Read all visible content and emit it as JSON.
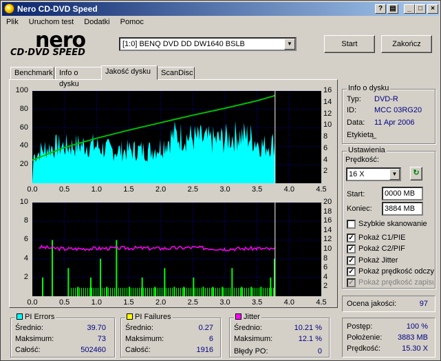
{
  "window": {
    "title": "Nero CD-DVD Speed",
    "title_buttons": [
      "?",
      "_",
      "□",
      "×"
    ]
  },
  "menu": [
    "Plik",
    "Uruchom test",
    "Dodatki",
    "Pomoc"
  ],
  "logo": {
    "brand": "nero",
    "sub": "CD·DVD SPEED"
  },
  "drive": {
    "selected": "[1:0]  BENQ DVD DD DW1640 BSLB"
  },
  "buttons": {
    "start": "Start",
    "close": "Zakończ"
  },
  "tabs": [
    {
      "label": "Benchmark"
    },
    {
      "label": "Info o dysku"
    },
    {
      "label": "Jakość dysku",
      "active": true
    },
    {
      "label": "ScanDisc"
    }
  ],
  "chart_data": [
    {
      "type": "area",
      "title": "PI Errors / read speed",
      "x_ticks": [
        "0.0",
        "0.5",
        "1.0",
        "1.5",
        "2.0",
        "2.5",
        "3.0",
        "3.5",
        "4.0",
        "4.5"
      ],
      "y_left_ticks": [
        "100",
        "80",
        "60",
        "40",
        "20"
      ],
      "y_right_ticks": [
        "16",
        "14",
        "12",
        "10",
        "8",
        "6",
        "4",
        "2"
      ],
      "xlim": [
        0,
        4.5
      ],
      "ylim": [
        0,
        100
      ],
      "y2lim": [
        0,
        16
      ],
      "scan_end_x": 3.78,
      "series": [
        {
          "name": "PI Errors",
          "color": "#00ffff",
          "x": [
            0.02,
            0.2,
            0.4,
            0.6,
            0.8,
            1.0,
            1.2,
            1.4,
            1.6,
            1.8,
            2.0,
            2.2,
            2.4,
            2.6,
            2.8,
            3.0,
            3.2,
            3.4,
            3.6,
            3.78
          ],
          "values": [
            30,
            38,
            40,
            40,
            42,
            40,
            36,
            35,
            36,
            35,
            40,
            52,
            50,
            48,
            46,
            48,
            52,
            50,
            40,
            44
          ]
        },
        {
          "name": "Read speed",
          "color": "#00c000",
          "x": [
            0.0,
            0.5,
            1.0,
            1.5,
            2.0,
            2.5,
            3.0,
            3.5,
            3.78
          ],
          "values": [
            4.0,
            6.2,
            7.8,
            9.2,
            10.5,
            11.8,
            13.0,
            14.3,
            15.2
          ]
        }
      ]
    },
    {
      "type": "bar",
      "title": "PI Failures / Jitter",
      "x_ticks": [
        "0.0",
        "0.5",
        "1.0",
        "1.5",
        "2.0",
        "2.5",
        "3.0",
        "3.5",
        "4.0",
        "4.5"
      ],
      "y_left_ticks": [
        "10",
        "8",
        "6",
        "4",
        "2"
      ],
      "y_right_ticks": [
        "20",
        "18",
        "16",
        "14",
        "12",
        "10",
        "8",
        "6",
        "4",
        "2"
      ],
      "xlim": [
        0,
        4.5
      ],
      "ylim": [
        0,
        10
      ],
      "y2lim": [
        0,
        20
      ],
      "scan_end_x": 3.78,
      "series": [
        {
          "name": "PI Failures",
          "color": "#00ff00",
          "x": [
            0.15,
            0.3,
            0.55,
            0.7,
            0.9,
            1.05,
            1.15,
            1.3,
            1.5,
            1.7,
            1.9,
            2.05,
            2.2,
            2.35,
            2.5,
            2.65,
            2.8,
            2.95,
            3.1,
            3.25,
            3.4,
            3.55,
            3.7,
            3.76
          ],
          "values": [
            2,
            6,
            3,
            1,
            2,
            4,
            1,
            6,
            1,
            2,
            1,
            3,
            1,
            1,
            2,
            1,
            1,
            1,
            3,
            1,
            1,
            1,
            2,
            4
          ]
        },
        {
          "name": "Jitter",
          "color": "#ff00ff",
          "x": [
            0.1,
            0.5,
            1.0,
            1.5,
            2.0,
            2.5,
            3.0,
            3.5,
            3.78
          ],
          "values": [
            10.5,
            10.1,
            10.2,
            10.3,
            10.2,
            10.4,
            10.1,
            10.2,
            10.0
          ]
        }
      ]
    }
  ],
  "disc_info": {
    "title": "Info o dysku",
    "rows": [
      {
        "label": "Typ:",
        "value": "DVD-R"
      },
      {
        "label": "ID:",
        "value": "MCC 03RG20"
      },
      {
        "label": "Data:",
        "value": "11 Apr 2006"
      },
      {
        "label": "Etykieta",
        "value": "_"
      }
    ]
  },
  "settings": {
    "title": "Ustawienia",
    "speed_label": "Prędkość:",
    "speed_value": "16 X",
    "start_label": "Start:",
    "start_value": "0000 MB",
    "end_label": "Koniec:",
    "end_value": "3884 MB",
    "checks": [
      {
        "label": "Szybkie skanowanie",
        "checked": false
      },
      {
        "label": "Pokaż C1/PIE",
        "checked": true
      },
      {
        "label": "Pokaż C2/PIF",
        "checked": true
      },
      {
        "label": "Pokaż Jitter",
        "checked": true
      },
      {
        "label": "Pokaż prędkość odczytu",
        "checked": true
      },
      {
        "label": "Pokaż prędkość zapisu",
        "checked": true,
        "disabled": true
      }
    ]
  },
  "quality": {
    "label": "Ocena jakości:",
    "value": "97"
  },
  "pi_errors": {
    "title": "PI Errors",
    "color": "#00ffff",
    "avg_label": "Średnio:",
    "avg": "39.70",
    "max_label": "Maksimum:",
    "max": "73",
    "total_label": "Całość:",
    "total": "502460"
  },
  "pi_failures": {
    "title": "PI Failures",
    "color": "#ffff00",
    "avg_label": "Średnio:",
    "avg": "0.27",
    "max_label": "Maksimum:",
    "max": "6",
    "total_label": "Całość:",
    "total": "1916"
  },
  "jitter": {
    "title": "Jitter",
    "color": "#ff00ff",
    "avg_label": "Średnio:",
    "avg": "10.21 %",
    "max_label": "Maksimum:",
    "max": "12.1 %",
    "po_label": "Błędy PO:",
    "po": "0"
  },
  "progress": {
    "progress_label": "Postęp:",
    "progress": "100 %",
    "position_label": "Położenie:",
    "position": "3883 MB",
    "speed_label": "Prędkość:",
    "speed": "15.30 X"
  }
}
